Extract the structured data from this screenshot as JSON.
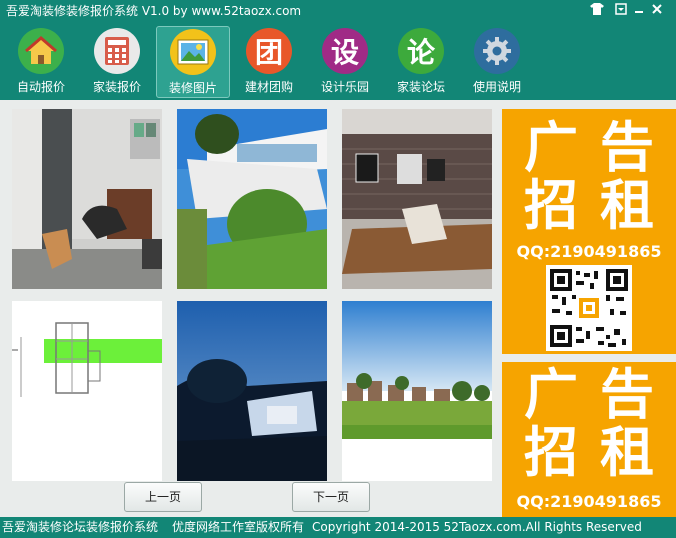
{
  "window": {
    "title": "吾爱淘装修装修报价系统 V1.0  by www.52taozx.com",
    "controls": [
      "shirt-icon",
      "restore-icon",
      "minimize-icon",
      "close-icon"
    ]
  },
  "toolbar": {
    "items": [
      {
        "label": "自动报价",
        "icon": "house-icon",
        "color": "#3cb04b"
      },
      {
        "label": "家装报价",
        "icon": "calculator-icon",
        "color": "#e9e9e9"
      },
      {
        "label": "装修图片",
        "icon": "picture-icon",
        "color": "#f2c21a"
      },
      {
        "label": "建材团购",
        "icon": "团",
        "color": "#e8572a"
      },
      {
        "label": "设计乐园",
        "icon": "设",
        "color": "#a02b86"
      },
      {
        "label": "家装论坛",
        "icon": "论",
        "color": "#3daa3c"
      },
      {
        "label": "使用说明",
        "icon": "gear-icon",
        "color": "#2e6d9e"
      }
    ],
    "active_index": 2
  },
  "gallery": {
    "thumbnails": [
      "living-room-photo",
      "modern-house-photo",
      "loft-interior-photo",
      "floor-plan-drawing",
      "night-house-photo",
      "village-landscape-photo"
    ]
  },
  "pager": {
    "prev_label": "上一页",
    "next_label": "下一页"
  },
  "ads": [
    {
      "line1a": "广",
      "line1b": "告",
      "line2a": "招",
      "line2b": "租",
      "qq": "QQ:2190491865"
    },
    {
      "line1a": "广",
      "line1b": "告",
      "line2a": "招",
      "line2b": "租",
      "qq": "QQ:2190491865"
    }
  ],
  "status": {
    "app": "吾爱淘装修论坛装修报价系统",
    "owner": "优度网络工作室版权所有",
    "copyright": "Copyright  2014-2015 52Taozx.com.All Rights Reserved"
  },
  "colors": {
    "accent": "#128676",
    "ad_bg": "#f6a400"
  }
}
